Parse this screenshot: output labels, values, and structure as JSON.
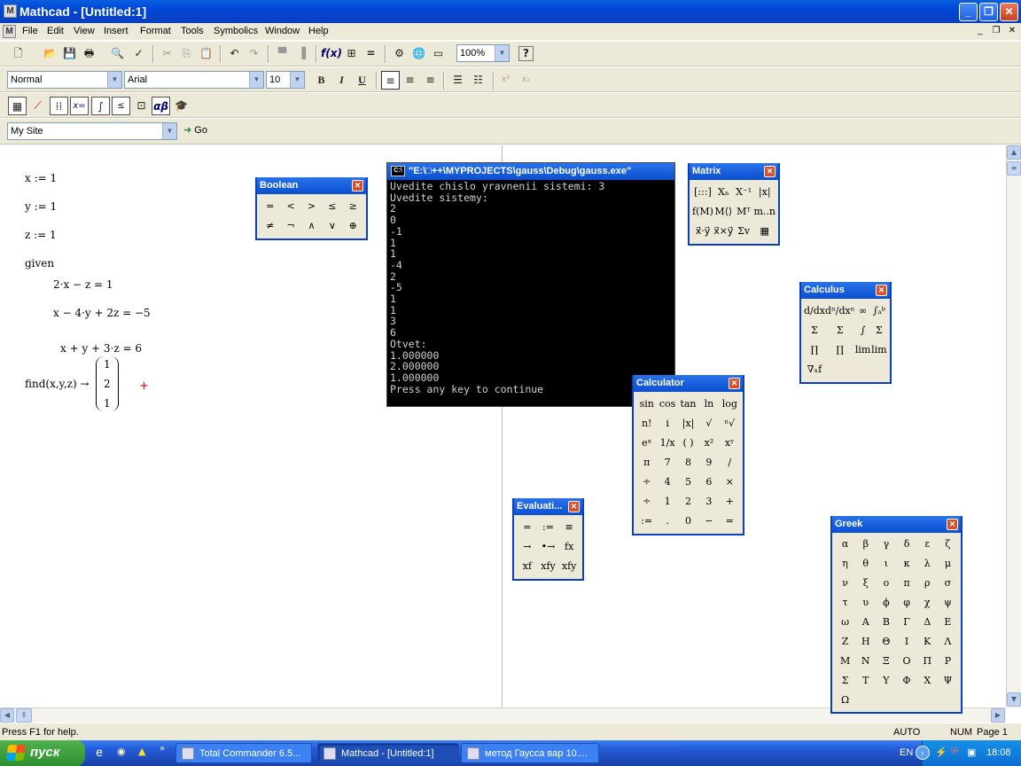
{
  "window": {
    "title": "Mathcad - [Untitled:1]"
  },
  "menu": [
    "File",
    "Edit",
    "View",
    "Insert",
    "Format",
    "Tools",
    "Symbolics",
    "Window",
    "Help"
  ],
  "toolbar": {
    "zoom": "100%",
    "style": "Normal",
    "font": "Arial",
    "size": "10",
    "address": "My Site",
    "go": "Go",
    "bold": "B",
    "italic": "I",
    "underline": "U"
  },
  "worksheet": {
    "lines": [
      "x := 1",
      "y := 1",
      "z := 1",
      "given",
      "2·x − z = 1",
      "x − 4·y + 2z = −5",
      "x + y + 3·z = 6",
      "find(x,y,z) →"
    ],
    "result": [
      "1",
      "2",
      "1"
    ],
    "cursor": "+"
  },
  "console": {
    "title": "\"E:\\□++\\MYPROJECTS\\gauss\\Debug\\gauss.exe\"",
    "lines": [
      "Uvedite chislo yravnenii sistemi: 3",
      "Uvedite sistemy:",
      "2",
      "0",
      "-1",
      "1",
      "1",
      "-4",
      "2",
      "-5",
      "1",
      "1",
      "3",
      "6",
      "Otvet:",
      "1.000000",
      "2.000000",
      "1.000000",
      "Press any key to continue"
    ]
  },
  "palettes": {
    "boolean": {
      "title": "Boolean",
      "cells": [
        "=",
        "<",
        ">",
        "≤",
        "≥",
        "≠",
        "¬",
        "∧",
        "∨",
        "⊕"
      ]
    },
    "matrix": {
      "title": "Matrix",
      "cells": [
        "[:::]",
        "Xₙ",
        "X⁻¹",
        "|x|",
        "f(M)",
        "M⟨⟩",
        "Mᵀ",
        "m..n",
        "x⃗·y⃗",
        "x⃗×y⃗",
        "Σv",
        "▦"
      ]
    },
    "calculus": {
      "title": "Calculus",
      "cells": [
        "d/dx",
        "dⁿ/dxⁿ",
        "∞",
        "∫ₐᵇ",
        "Σ",
        "Σ",
        "∫",
        "Σ",
        "∏",
        "∏",
        "lim",
        "lim",
        "∇ₓf"
      ]
    },
    "calculator": {
      "title": "Calculator",
      "cells": [
        "sin",
        "cos",
        "tan",
        "ln",
        "log",
        "n!",
        "i",
        "|x|",
        "√",
        "ⁿ√",
        "eˣ",
        "1/x",
        "( )",
        "x²",
        "xʸ",
        "π",
        "7",
        "8",
        "9",
        "/",
        "÷",
        "4",
        "5",
        "6",
        "×",
        "÷",
        "1",
        "2",
        "3",
        "+",
        ":=",
        ".",
        "0",
        "−",
        "="
      ]
    },
    "evaluation": {
      "title": "Evaluati...",
      "cells": [
        "=",
        ":=",
        "≡",
        "→",
        "•→",
        "fx",
        "xf",
        "xfy",
        "xfy"
      ]
    },
    "greek": {
      "title": "Greek",
      "cells": [
        "α",
        "β",
        "γ",
        "δ",
        "ε",
        "ζ",
        "η",
        "θ",
        "ι",
        "κ",
        "λ",
        "μ",
        "ν",
        "ξ",
        "ο",
        "π",
        "ρ",
        "σ",
        "τ",
        "υ",
        "ϕ",
        "φ",
        "χ",
        "ψ",
        "ω",
        "Α",
        "Β",
        "Γ",
        "Δ",
        "Ε",
        "Ζ",
        "Η",
        "Θ",
        "Ι",
        "Κ",
        "Λ",
        "Μ",
        "Ν",
        "Ξ",
        "Ο",
        "Π",
        "Ρ",
        "Σ",
        "Τ",
        "Υ",
        "Φ",
        "Χ",
        "Ψ",
        "Ω"
      ]
    }
  },
  "status": {
    "help": "Press F1 for help.",
    "mode": "AUTO",
    "num": "NUM",
    "page": "Page 1"
  },
  "taskbar": {
    "start": "пуск",
    "tasks": [
      "Total Commander 6.5...",
      "Mathcad - [Untitled:1]",
      "метод Гаусса вар 10...."
    ],
    "lang": "EN",
    "clock": "18:08"
  }
}
